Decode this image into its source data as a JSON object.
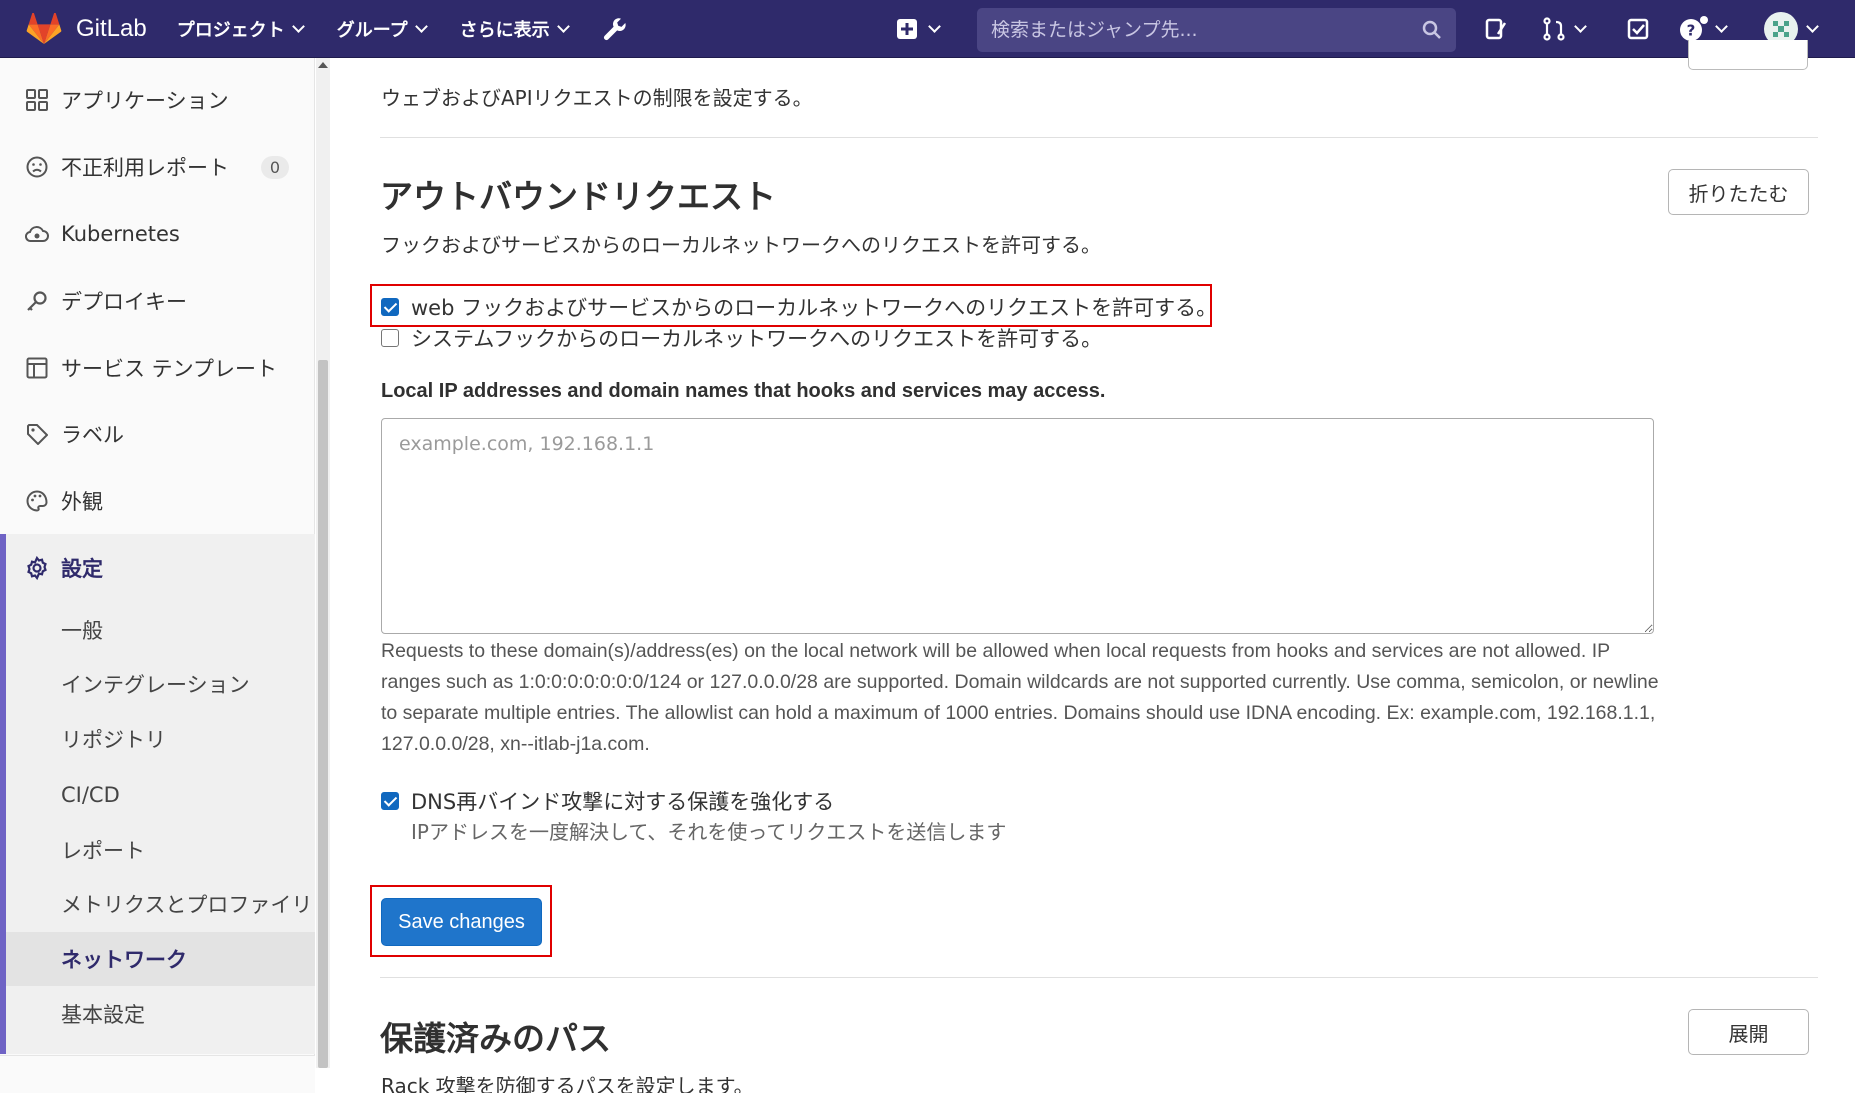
{
  "navbar": {
    "brand": "GitLab",
    "menu": [
      {
        "label": "プロジェクト"
      },
      {
        "label": "グループ"
      },
      {
        "label": "さらに表示"
      }
    ],
    "search_placeholder": "検索またはジャンプ先...",
    "icons": [
      "wrench-icon",
      "plus-square-icon",
      "search-icon",
      "issues-icon",
      "merge-request-icon",
      "todo-icon",
      "help-icon",
      "avatar"
    ]
  },
  "sidebar": {
    "items": [
      {
        "label": "アプリケーション",
        "icon": "grid-icon"
      },
      {
        "label": "不正利用レポート",
        "icon": "frown-icon",
        "badge": "0"
      },
      {
        "label": "Kubernetes",
        "icon": "cloud-gear-icon"
      },
      {
        "label": "デプロイキー",
        "icon": "key-icon"
      },
      {
        "label": "サービス テンプレート",
        "icon": "template-icon"
      },
      {
        "label": "ラベル",
        "icon": "label-icon"
      },
      {
        "label": "外観",
        "icon": "palette-icon"
      },
      {
        "label": "設定",
        "icon": "gear-icon"
      }
    ],
    "sub_items": [
      {
        "label": "一般"
      },
      {
        "label": "インテグレーション"
      },
      {
        "label": "リポジトリ"
      },
      {
        "label": "CI/CD"
      },
      {
        "label": "レポート"
      },
      {
        "label": "メトリクスとプロファイリング"
      },
      {
        "label": "ネットワーク",
        "active": true
      },
      {
        "label": "基本設定"
      }
    ]
  },
  "main": {
    "prev_section_desc": "ウェブおよびAPIリクエストの制限を設定する。",
    "outbound": {
      "title": "アウトバウンドリクエスト",
      "collapse_label": "折りたたむ",
      "desc": "フックおよびサービスからのローカルネットワークへのリクエストを許可する。",
      "cb_web_hooks": "web フックおよびサービスからのローカルネットワークへのリクエストを許可する。",
      "cb_system_hooks": "システムフックからのローカルネットワークへのリクエストを許可する。",
      "allowlist_label": "Local IP addresses and domain names that hooks and services may access.",
      "allowlist_placeholder": "example.com, 192.168.1.1",
      "help_text": "Requests to these domain(s)/address(es) on the local network will be allowed when local requests from hooks and services are not allowed. IP ranges such as 1:0:0:0:0:0:0:0/124 or 127.0.0.0/28 are supported. Domain wildcards are not supported currently. Use comma, semicolon, or newline to separate multiple entries. The allowlist can hold a maximum of 1000 entries. Domains should use IDNA encoding. Ex: example.com, 192.168.1.1, 127.0.0.0/28, xn--itlab-j1a.com.",
      "cb_dns": "DNS再バインド攻撃に対する保護を強化する",
      "dns_desc": "IPアドレスを一度解決して、それを使ってリクエストを送信します",
      "save_label": "Save changes"
    },
    "protected_paths": {
      "title": "保護済みのパス",
      "expand_label": "展開",
      "desc": "Rack 攻撃を防御するパスを設定します。"
    }
  },
  "colors": {
    "navbar": "#2f2a6b",
    "primary": "#1f75cb",
    "highlight": "#e00000"
  }
}
